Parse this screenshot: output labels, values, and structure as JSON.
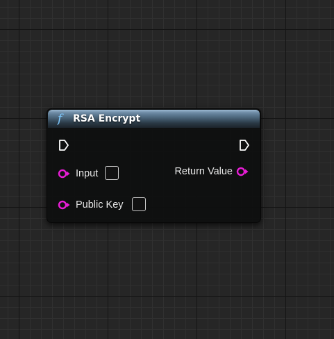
{
  "node": {
    "title": "RSA Encrypt",
    "header_icon": "function-icon",
    "header_icon_glyph": "f",
    "inputs": [
      {
        "label": "Input",
        "type": "string"
      },
      {
        "label": "Public Key",
        "type": "string"
      }
    ],
    "outputs": [
      {
        "label": "Return Value",
        "type": "string"
      }
    ]
  },
  "colors": {
    "pin_string": "#e81dd6",
    "header": "#4a6479",
    "function_icon": "#7ec9ff",
    "background": "#262626"
  }
}
